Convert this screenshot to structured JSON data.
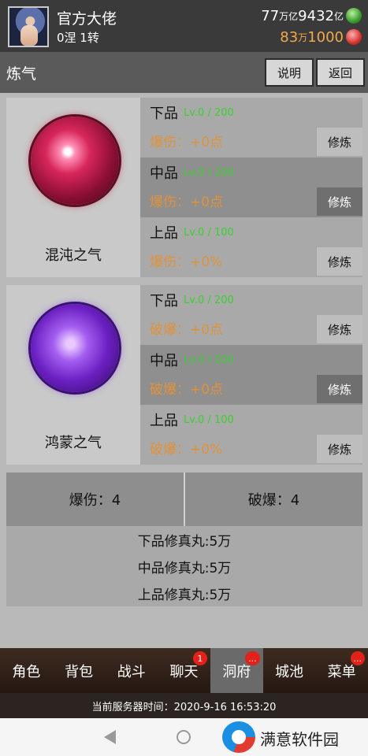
{
  "header": {
    "player_name": "官方大佬",
    "rank": "0涅 1转",
    "jade_prefix": "77",
    "jade_unit1": "万亿",
    "jade_mid": "9432",
    "jade_unit2": "亿",
    "ruby_prefix": "83",
    "ruby_unit": "万",
    "ruby_rest": "1000"
  },
  "titlebar": {
    "title": "炼气",
    "help_label": "说明",
    "back_label": "返回"
  },
  "panels": [
    {
      "name": "混沌之气",
      "grades": [
        {
          "name": "下品",
          "level": "Lv.0 / 200",
          "bonus": "爆伤：+0点",
          "button": "修炼"
        },
        {
          "name": "中品",
          "level": "Lv.0 / 200",
          "bonus": "爆伤：+0点",
          "button": "修炼"
        },
        {
          "name": "上品",
          "level": "Lv.0 / 100",
          "bonus": "爆伤：+0%",
          "button": "修炼"
        }
      ]
    },
    {
      "name": "鸿蒙之气",
      "grades": [
        {
          "name": "下品",
          "level": "Lv.0 / 200",
          "bonus": "破爆：+0点",
          "button": "修炼"
        },
        {
          "name": "中品",
          "level": "Lv.0 / 200",
          "bonus": "破爆：+0点",
          "button": "修炼"
        },
        {
          "name": "上品",
          "level": "Lv.0 / 100",
          "bonus": "破爆：+0%",
          "button": "修炼"
        }
      ]
    }
  ],
  "stats": {
    "crit_damage": "爆伤：4",
    "crit_break": "破爆：4"
  },
  "pills": [
    "下品修真丸:5万",
    "中品修真丸:5万",
    "上品修真丸:5万"
  ],
  "nav": [
    {
      "label": "角色",
      "badge": ""
    },
    {
      "label": "背包",
      "badge": ""
    },
    {
      "label": "战斗",
      "badge": ""
    },
    {
      "label": "聊天",
      "badge": "1"
    },
    {
      "label": "洞府",
      "badge": "..."
    },
    {
      "label": "城池",
      "badge": ""
    },
    {
      "label": "菜单",
      "badge": "..."
    }
  ],
  "server_time": "当前服务器时间：2020-9-16 16:53:20",
  "watermark": "满意软件园",
  "colors": {
    "level_green": "#39d12e",
    "bonus_orange": "#e0923a",
    "badge_red": "#e3211b"
  }
}
